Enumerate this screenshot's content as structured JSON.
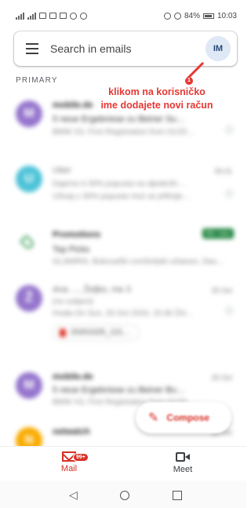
{
  "status_bar": {
    "battery": "84%",
    "time": "10:03"
  },
  "search": {
    "placeholder": "Search in emails",
    "avatar_initials": "IM"
  },
  "section": "PRIMARY",
  "annotation": {
    "marker": "1",
    "line1": "klikom na korisničko",
    "line2": "ime dodajete novi račun",
    "color": "#e53935"
  },
  "emails": [
    {
      "avatar": "M",
      "color": "#9575cd",
      "sender": "mobile.de",
      "subject": "5 neue Ergebnisse zu Beiner Su…",
      "preview": "BMW X3, First Registration from 01/20…",
      "date": ""
    },
    {
      "avatar": "U",
      "color": "#4dc3d8",
      "sender": "Uber",
      "subject": "Dajemo ti 30% popusta na sljedećih…",
      "preview": "Uživaj u 30% popusta Vozi se jeftinije…",
      "date": "06.01"
    },
    {
      "sender": "Promotions",
      "subject": "Top Picks",
      "preview": "GLAMIRA, Bukovački comfortjski urbanex, Das…",
      "badge": "99+ new"
    },
    {
      "avatar": "Ž",
      "color": "#9575cd",
      "sender": "Ana …, Željko, me 3",
      "subject": "(no subject)",
      "preview": "Hvala On Sun, 25 Oct 2020, 15:36 Žel…",
      "date": "25 Oct",
      "attachment": "20201025_121…"
    },
    {
      "avatar": "M",
      "color": "#9575cd",
      "sender": "mobile.de",
      "subject": "5 neue Ergebnisse zu Beiner Bu…",
      "preview": "BMW X3, First Registration from 01/20…",
      "date": "25 Oct"
    },
    {
      "avatar": "N",
      "color": "#f9ab00",
      "sender": "netwatch",
      "subject": "",
      "preview": "",
      "date": "25 Oct"
    }
  ],
  "compose": {
    "label": "Compose"
  },
  "bottom_nav": {
    "mail_label": "Mail",
    "mail_badge": "99+",
    "meet_label": "Meet"
  }
}
